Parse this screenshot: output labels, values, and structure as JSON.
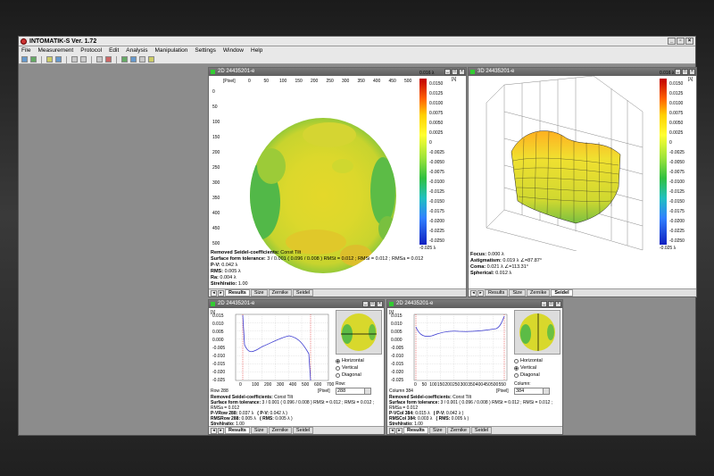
{
  "app": {
    "title": "INTOMATIK-S Ver. 1.72"
  },
  "menu": [
    "File",
    "Measurement",
    "Protocol",
    "Edit",
    "Analysis",
    "Manipulation",
    "Settings",
    "Window",
    "Help"
  ],
  "win2d": {
    "title": "2D 24435201-e",
    "axis_unit": "[Pixel]",
    "x_ticks": [
      "0",
      "50",
      "100",
      "150",
      "200",
      "250",
      "300",
      "350",
      "400",
      "450",
      "500"
    ],
    "y_ticks": [
      "0",
      "50",
      "100",
      "150",
      "200",
      "250",
      "300",
      "350",
      "400",
      "450",
      "500"
    ],
    "colorbar": {
      "top": "0.016 λ",
      "unit": "[λ]",
      "bottom": "-0.025 λ",
      "ticks": [
        "0.0150",
        "0.0125",
        "0.0100",
        "0.0075",
        "0.0050",
        "0.0025",
        "0",
        "-0.0025",
        "-0.0050",
        "-0.0075",
        "-0.0100",
        "-0.0125",
        "-0.0150",
        "-0.0175",
        "-0.0200",
        "-0.0225",
        "-0.0250"
      ]
    },
    "results": {
      "removed_label": "Removed Seidel-coefficients:",
      "removed_value": "Const Tilt",
      "sft_label": "Surface form tolerance:",
      "sft_value": "3 / 0.001  ( 0.096 / 0.008 ) RMSt = 0.012 ; RMSi = 0.012 ; RMSa = 0.012",
      "pv_label": "P-V:",
      "pv_value": "0.042 λ",
      "rms_label": "RMS:",
      "rms_value": "0.005 λ",
      "ra_label": "Ra:",
      "ra_value": "0.004 λ",
      "strehl_label": "Strehlratio:",
      "strehl_value": "1.00"
    },
    "tabs": [
      "Results",
      "Size",
      "Zernike",
      "Seidel"
    ],
    "active_tab": "Results"
  },
  "win3d": {
    "title": "3D 24435201-e",
    "colorbar": {
      "top": "0.016 λ",
      "unit": "[λ]",
      "bottom": "-0.025 λ",
      "ticks": [
        "0.0150",
        "0.0125",
        "0.0100",
        "0.0075",
        "0.0050",
        "0.0025",
        "0",
        "-0.0025",
        "-0.0050",
        "-0.0075",
        "-0.0100",
        "-0.0125",
        "-0.0150",
        "-0.0175",
        "-0.0200",
        "-0.0225",
        "-0.0250"
      ]
    },
    "results": {
      "focus_label": "Focus:",
      "focus_value": "0.000 λ",
      "astig_label": "Astigmatism:",
      "astig_value": "0.019 λ   ∠=87.87°",
      "coma_label": "Coma:",
      "coma_value": "0.021 λ   ∠=113.31°",
      "spherical_label": "Spherical:",
      "spherical_value": "0.012 λ"
    },
    "tabs": [
      "Results",
      "Size",
      "Zernike",
      "Seidel"
    ],
    "active_tab": "Seidel"
  },
  "profile_row": {
    "title": "2D 24435201-e",
    "yunit": "[λ]",
    "y_ticks": [
      "0.015",
      "0.010",
      "0.005",
      "0.000",
      "-0.005",
      "-0.010",
      "-0.015",
      "-0.020",
      "-0.025"
    ],
    "x_ticks": [
      "0",
      "100",
      "200",
      "300",
      "400",
      "500",
      "600",
      "700"
    ],
    "xunit": "[Pixel]",
    "pos_label": "Row 288",
    "radios": [
      "Horizontal",
      "Vertical",
      "Diagonal"
    ],
    "selected": 0,
    "field_label": "Row:",
    "field_value": "288",
    "results": {
      "removed_label": "Removed Seidel-coefficients:",
      "removed_value": "Const Tilt",
      "sft_label": "Surface form tolerance:",
      "sft_value": "3 / 0.001  ( 0.096 / 0.008 ) RMSt = 0.012 ; RMSi = 0.012 ; RMSa = 0.012",
      "pv_label": "P-VRow 288:",
      "pv_value": "0.037 λ",
      "pv2_label": "( P-V:",
      "pv2_value": "0.042 λ )",
      "rms_label": "RMSRow 288:",
      "rms_value": "0.005 λ",
      "rms2_label": "( RMS:",
      "rms2_value": "0.005 λ )",
      "strehl_label": "Strehlratio:",
      "strehl_value": "1.00"
    },
    "tabs": [
      "Results",
      "Size",
      "Zernike",
      "Seidel"
    ],
    "active_tab": "Results"
  },
  "profile_col": {
    "title": "2D 24435201-e",
    "yunit": "[λ]",
    "y_ticks": [
      "0.015",
      "0.010",
      "0.005",
      "0.000",
      "-0.005",
      "-0.010",
      "-0.015",
      "-0.020",
      "-0.025"
    ],
    "x_ticks": [
      "0",
      "50",
      "100",
      "150",
      "200",
      "250",
      "300",
      "350",
      "400",
      "450",
      "500",
      "550"
    ],
    "xunit": "[Pixel]",
    "pos_label": "Column 384",
    "radios": [
      "Horizontal",
      "Vertical",
      "Diagonal"
    ],
    "selected": 1,
    "field_label": "Column:",
    "field_value": "384",
    "results": {
      "removed_label": "Removed Seidel-coefficients:",
      "removed_value": "Const Tilt",
      "sft_label": "Surface form tolerance:",
      "sft_value": "3 / 0.001  ( 0.096 / 0.008 ) RMSt = 0.012 ; RMSi = 0.012 ; RMSa = 0.012",
      "pv_label": "P-VCol 384:",
      "pv_value": "0.015 λ",
      "pv2_label": "( P-V:",
      "pv2_value": "0.042 λ )",
      "rms_label": "RMSCol 384:",
      "rms_value": "0.003 λ",
      "rms2_label": "( RMS:",
      "rms2_value": "0.005 λ )",
      "strehl_label": "Strehlratio:",
      "strehl_value": "1.00"
    },
    "tabs": [
      "Results",
      "Size",
      "Zernike",
      "Seidel"
    ],
    "active_tab": "Results"
  },
  "colors": {
    "chrome": "#e8e8e8",
    "workspace": "#8c8c8c",
    "curve": "#3a3ad0",
    "marker": "#e03030"
  }
}
